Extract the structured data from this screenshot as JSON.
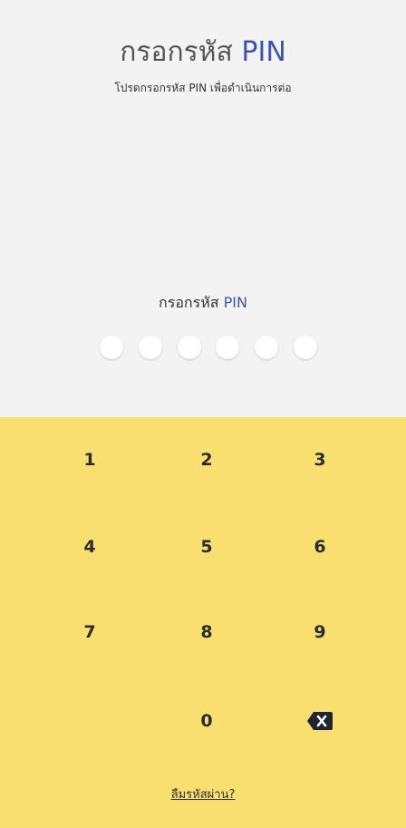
{
  "header": {
    "title_main": "กรอกรหัส",
    "title_accent": "PIN",
    "subtitle": "โปรดกรอกรหัส PIN เพื่อดำเนินการต่อ"
  },
  "pin": {
    "label_main": "กรอกรหัส",
    "label_accent": "PIN",
    "digits_entered": 0,
    "total_digits": 6
  },
  "keypad": {
    "keys": [
      "1",
      "2",
      "3",
      "4",
      "5",
      "6",
      "7",
      "8",
      "9",
      "0"
    ],
    "backspace_icon": "backspace-icon"
  },
  "footer": {
    "forgot_label": "ลืมรหัสผ่าน?"
  },
  "colors": {
    "accent": "#3d55a6",
    "keypad_bg": "#f8df6f",
    "top_bg": "#f3f3f3"
  }
}
